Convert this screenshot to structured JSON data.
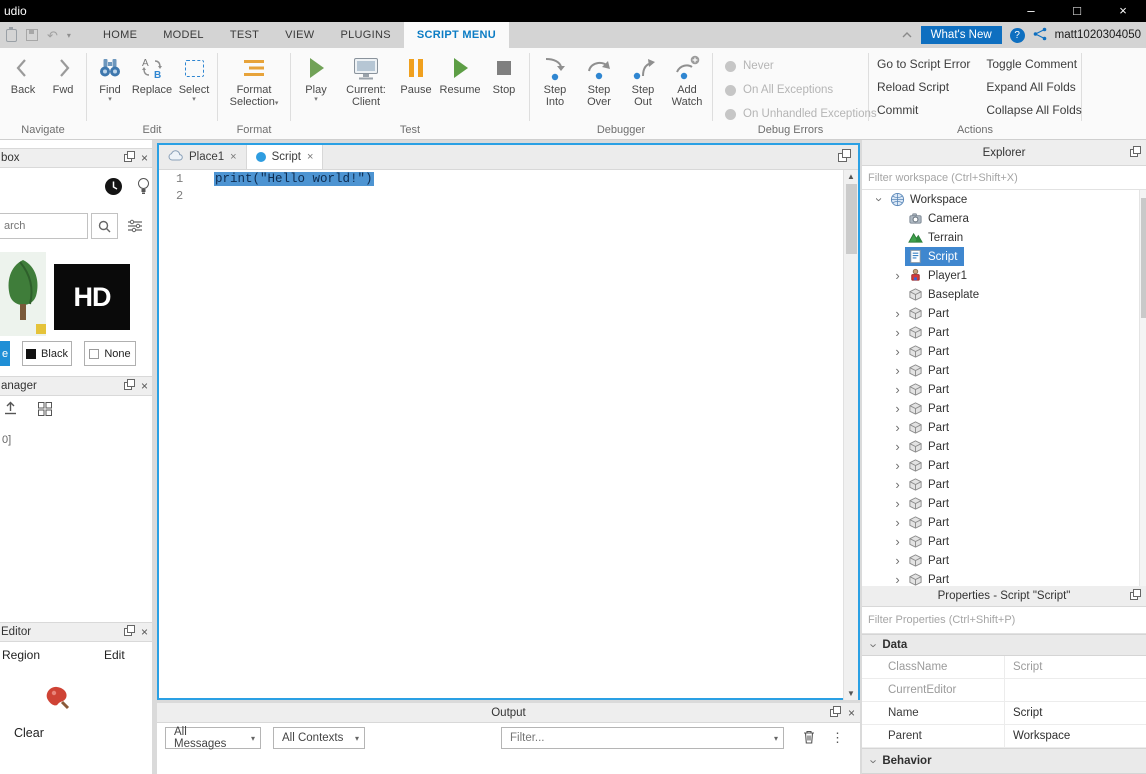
{
  "window": {
    "title": "udio",
    "minimize": "–",
    "maximize": "□",
    "close": "×"
  },
  "icons": {
    "close": "×",
    "dropdown": "▾",
    "chevron": "›",
    "menu_dots": "⋮",
    "help": "?"
  },
  "colors": {
    "accent_blue": "#0b7cc4",
    "selection_blue": "#3f87cf",
    "whats_new_blue": "#0e6fc0",
    "editor_border_blue": "#2aa0e4",
    "play_green": "#5d9e45",
    "pause_orange": "#f0a01e"
  },
  "menubar": {
    "tabs": [
      {
        "label": "HOME",
        "active": false
      },
      {
        "label": "MODEL",
        "active": false
      },
      {
        "label": "TEST",
        "active": false
      },
      {
        "label": "VIEW",
        "active": false
      },
      {
        "label": "PLUGINS",
        "active": false
      },
      {
        "label": "SCRIPT MENU",
        "active": true
      }
    ],
    "whats_new": "What's New",
    "username": "matt1020304050"
  },
  "ribbon": {
    "navigate": {
      "label": "Navigate",
      "back": "Back",
      "fwd": "Fwd"
    },
    "edit": {
      "label": "Edit",
      "find": "Find",
      "replace": "Replace",
      "select": "Select"
    },
    "format": {
      "label": "Format",
      "line1": "Format",
      "line2": "Selection"
    },
    "test": {
      "label": "Test",
      "play": "Play",
      "current_line1": "Current:",
      "current_line2": "Client",
      "pause": "Pause",
      "resume": "Resume",
      "stop": "Stop"
    },
    "debugger": {
      "label": "Debugger",
      "buttons": [
        {
          "line1": "Step",
          "line2": "Into"
        },
        {
          "line1": "Step",
          "line2": "Over"
        },
        {
          "line1": "Step",
          "line2": "Out"
        },
        {
          "line1": "Add",
          "line2": "Watch"
        }
      ]
    },
    "debug_errors": {
      "label": "Debug Errors",
      "options": [
        "Never",
        "On All Exceptions",
        "On Unhandled Exceptions"
      ]
    },
    "actions": {
      "label": "Actions",
      "column1": [
        "Go to Script Error",
        "Reload Script",
        "Commit"
      ],
      "column2": [
        "Toggle Comment",
        "Expand All Folds",
        "Collapse All Folds"
      ]
    }
  },
  "left_panel": {
    "toolbox_header": "box",
    "search_placeholder": "arch",
    "hd_label": "HD",
    "black_button": "Black",
    "none_button": "None",
    "side_tab": "e",
    "manager_header": "anager",
    "index_text": "0]",
    "editor_header": "Editor",
    "region_tab": "Region",
    "edit_tab": "Edit",
    "clear_label": "Clear"
  },
  "editor": {
    "tabs": [
      {
        "label": "Place1",
        "active": false
      },
      {
        "label": "Script",
        "active": true
      }
    ],
    "line_numbers": [
      "1",
      "2"
    ],
    "code_line_1": "print(\"Hello world!\")"
  },
  "output": {
    "title": "Output",
    "messages_dropdown": "All Messages",
    "contexts_dropdown": "All Contexts",
    "filter_placeholder": "Filter..."
  },
  "explorer": {
    "title": "Explorer",
    "filter_placeholder": "Filter workspace (Ctrl+Shift+X)",
    "tree": [
      {
        "label": "Workspace",
        "icon": "workspace",
        "indent": 0,
        "expander": "expanded",
        "selected": false
      },
      {
        "label": "Camera",
        "icon": "camera",
        "indent": 1,
        "expander": "none",
        "selected": false
      },
      {
        "label": "Terrain",
        "icon": "terrain",
        "indent": 1,
        "expander": "none",
        "selected": false
      },
      {
        "label": "Script",
        "icon": "script",
        "indent": 1,
        "expander": "none",
        "selected": true
      },
      {
        "label": "Player1",
        "icon": "player",
        "indent": 1,
        "expander": "collapsed",
        "selected": false
      },
      {
        "label": "Baseplate",
        "icon": "part",
        "indent": 1,
        "expander": "none",
        "selected": false
      },
      {
        "label": "Part",
        "icon": "part",
        "indent": 1,
        "expander": "collapsed",
        "selected": false
      },
      {
        "label": "Part",
        "icon": "part",
        "indent": 1,
        "expander": "collapsed",
        "selected": false
      },
      {
        "label": "Part",
        "icon": "part",
        "indent": 1,
        "expander": "collapsed",
        "selected": false
      },
      {
        "label": "Part",
        "icon": "part",
        "indent": 1,
        "expander": "collapsed",
        "selected": false
      },
      {
        "label": "Part",
        "icon": "part",
        "indent": 1,
        "expander": "collapsed",
        "selected": false
      },
      {
        "label": "Part",
        "icon": "part",
        "indent": 1,
        "expander": "collapsed",
        "selected": false
      },
      {
        "label": "Part",
        "icon": "part",
        "indent": 1,
        "expander": "collapsed",
        "selected": false
      },
      {
        "label": "Part",
        "icon": "part",
        "indent": 1,
        "expander": "collapsed",
        "selected": false
      },
      {
        "label": "Part",
        "icon": "part",
        "indent": 1,
        "expander": "collapsed",
        "selected": false
      },
      {
        "label": "Part",
        "icon": "part",
        "indent": 1,
        "expander": "collapsed",
        "selected": false
      },
      {
        "label": "Part",
        "icon": "part",
        "indent": 1,
        "expander": "collapsed",
        "selected": false
      },
      {
        "label": "Part",
        "icon": "part",
        "indent": 1,
        "expander": "collapsed",
        "selected": false
      },
      {
        "label": "Part",
        "icon": "part",
        "indent": 1,
        "expander": "collapsed",
        "selected": false
      },
      {
        "label": "Part",
        "icon": "part",
        "indent": 1,
        "expander": "collapsed",
        "selected": false
      },
      {
        "label": "Part",
        "icon": "part",
        "indent": 1,
        "expander": "collapsed",
        "selected": false
      }
    ]
  },
  "properties": {
    "title": "Properties - Script \"Script\"",
    "filter_placeholder": "Filter Properties (Ctrl+Shift+P)",
    "data_section": "Data",
    "behavior_section": "Behavior",
    "rows": [
      {
        "name": "ClassName",
        "value": "Script",
        "readonly": true
      },
      {
        "name": "CurrentEditor",
        "value": "",
        "readonly": true
      },
      {
        "name": "Name",
        "value": "Script",
        "readonly": false
      },
      {
        "name": "Parent",
        "value": "Workspace",
        "readonly": false
      }
    ]
  }
}
